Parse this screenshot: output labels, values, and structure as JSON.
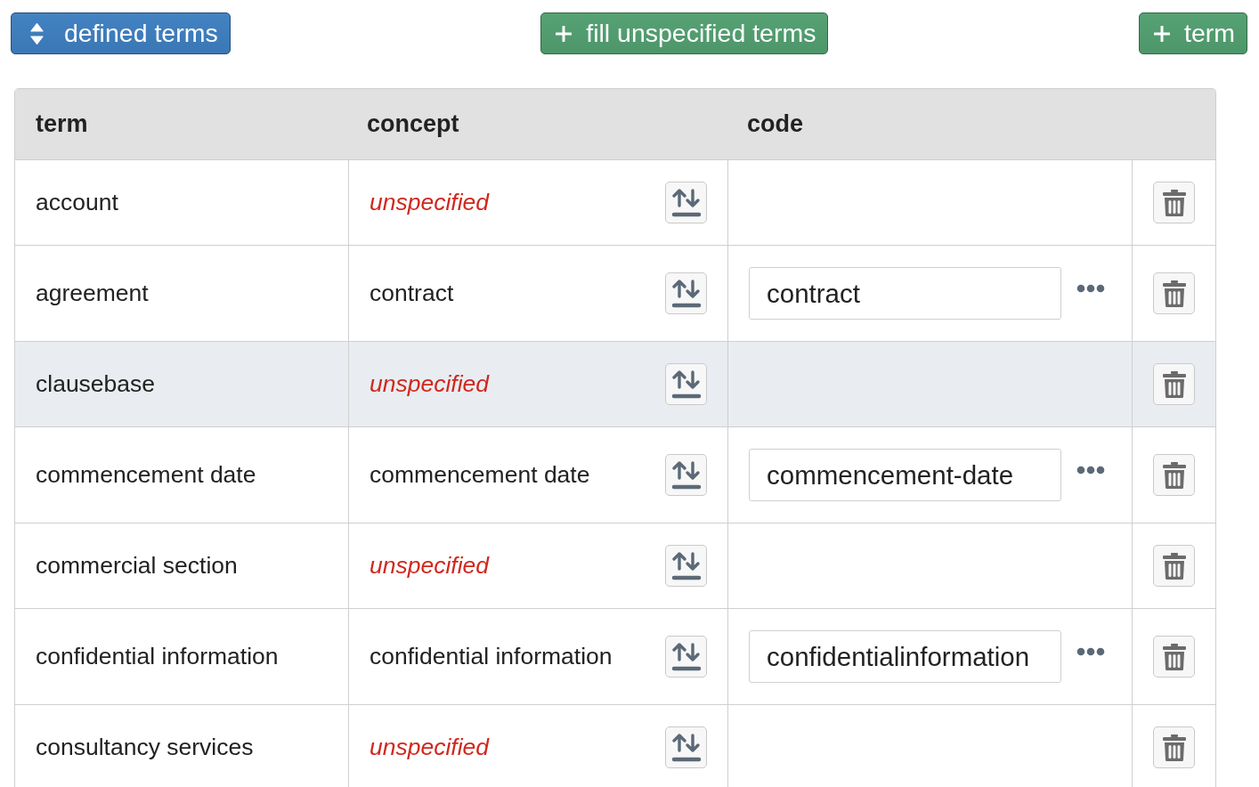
{
  "toolbar": {
    "buttons": [
      {
        "kind": "sort",
        "label": "defined terms"
      },
      {
        "kind": "add",
        "label": "fill unspecified terms"
      },
      {
        "kind": "add",
        "label": "term"
      }
    ]
  },
  "table": {
    "columns": [
      "term",
      "concept",
      "code"
    ],
    "rows": [
      {
        "term": "account",
        "concept": {
          "text": "unspecified",
          "unspecified": true
        },
        "highlighted": false
      },
      {
        "term": "agreement",
        "concept": {
          "text": "contract",
          "unspecified": false
        },
        "code": "contract",
        "highlighted": false
      },
      {
        "term": "clausebase",
        "concept": {
          "text": "unspecified",
          "unspecified": true
        },
        "highlighted": true
      },
      {
        "term": "commencement date",
        "concept": {
          "text": "commencement date",
          "unspecified": false
        },
        "code": "commencement-date",
        "highlighted": false
      },
      {
        "term": "commercial section",
        "concept": {
          "text": "unspecified",
          "unspecified": true
        },
        "highlighted": false
      },
      {
        "term": "confidential information",
        "concept": {
          "text": "confidential information",
          "unspecified": false
        },
        "code": "confidentialinformation",
        "highlighted": false
      },
      {
        "term": "consultancy services",
        "concept": {
          "text": "unspecified",
          "unspecified": true
        },
        "highlighted": false
      }
    ]
  }
}
